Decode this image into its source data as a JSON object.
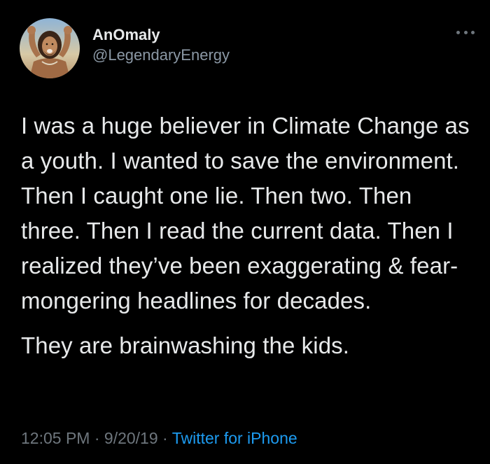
{
  "author": {
    "display_name": "AnOmaly",
    "handle": "@LegendaryEnergy"
  },
  "tweet": {
    "paragraphs": [
      "I was a huge believer in Climate Change as a youth. I wanted to save the environment. Then I caught one lie. Then two. Then three. Then I read the current data. Then I realized they’ve been exaggerating & fear-mongering headlines for decades.",
      "They are brainwashing the kids."
    ],
    "time": "12:05 PM",
    "separator": "·",
    "date": "9/20/19",
    "source": "Twitter for iPhone"
  },
  "icons": {
    "more": "more-horizontal-icon",
    "avatar": "profile-photo"
  },
  "colors": {
    "background": "#000000",
    "text_primary": "#e7e9ea",
    "text_secondary": "#6e767d",
    "link": "#1d9bf0"
  }
}
